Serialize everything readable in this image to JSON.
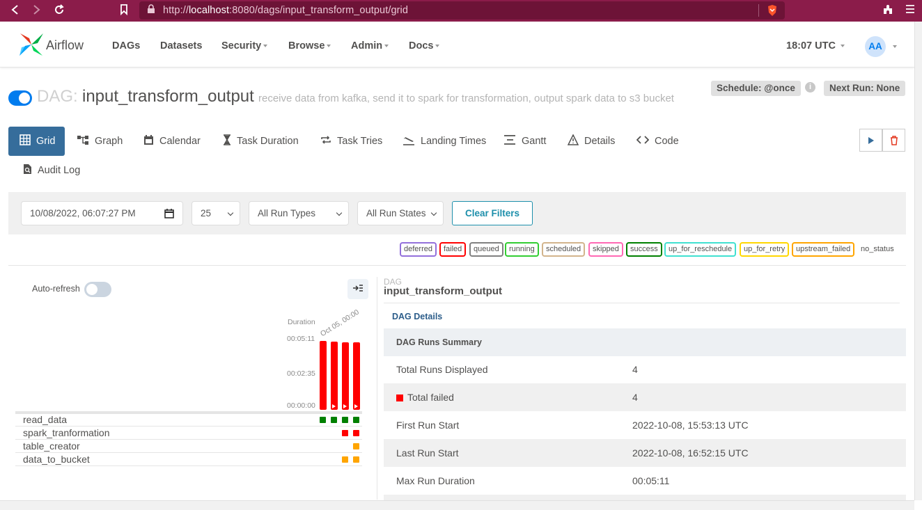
{
  "browser": {
    "url_prefix": "http://",
    "url_host": "localhost",
    "url_path": ":8080/dags/input_transform_output/grid"
  },
  "nav": {
    "brand": "Airflow",
    "items": [
      {
        "label": "DAGs"
      },
      {
        "label": "Datasets"
      },
      {
        "label": "Security"
      },
      {
        "label": "Browse"
      },
      {
        "label": "Admin"
      },
      {
        "label": "Docs"
      }
    ],
    "time": "18:07 UTC",
    "user_initials": "AA"
  },
  "dag": {
    "prefix": "DAG:",
    "name": "input_transform_output",
    "description": "receive data from kafka, send it to spark for transformation, output spark data to s3 bucket",
    "schedule": "Schedule: @once",
    "next_run": "Next Run: None"
  },
  "tabs": [
    {
      "label": "Grid",
      "icon": "grid-icon"
    },
    {
      "label": "Graph",
      "icon": "graph-icon"
    },
    {
      "label": "Calendar",
      "icon": "calendar-icon"
    },
    {
      "label": "Task Duration",
      "icon": "hourglass-icon"
    },
    {
      "label": "Task Tries",
      "icon": "retry-icon"
    },
    {
      "label": "Landing Times",
      "icon": "landing-icon"
    },
    {
      "label": "Gantt",
      "icon": "gantt-icon"
    },
    {
      "label": "Details",
      "icon": "warning-icon"
    },
    {
      "label": "Code",
      "icon": "code-icon"
    },
    {
      "label": "Audit Log",
      "icon": "audit-icon"
    }
  ],
  "filters": {
    "date": "10/08/2022, 06:07:27 PM",
    "limit": "25",
    "run_types": "All Run Types",
    "run_states": "All Run States",
    "clear": "Clear Filters"
  },
  "legend": [
    {
      "label": "deferred",
      "color": "#9370db"
    },
    {
      "label": "failed",
      "color": "#ff0000"
    },
    {
      "label": "queued",
      "color": "#808080"
    },
    {
      "label": "running",
      "color": "#32cd32"
    },
    {
      "label": "scheduled",
      "color": "#d2b48c"
    },
    {
      "label": "skipped",
      "color": "#ff69b4"
    },
    {
      "label": "success",
      "color": "#008000"
    },
    {
      "label": "up_for_reschedule",
      "color": "#40e0d0"
    },
    {
      "label": "up_for_retry",
      "color": "#ffd700"
    },
    {
      "label": "upstream_failed",
      "color": "#ffa500"
    },
    {
      "label": "no_status",
      "color": ""
    }
  ],
  "grid": {
    "auto_refresh": "Auto-refresh",
    "duration_label": "Duration",
    "date_label": "Oct 05, 00:00",
    "axis_ticks": [
      "00:05:11",
      "00:02:35",
      "00:00:00"
    ],
    "runs": [
      {
        "state": "failed",
        "duration_fraction": 0.97
      },
      {
        "state": "failed",
        "duration_fraction": 0.96
      },
      {
        "state": "failed",
        "duration_fraction": 0.95
      },
      {
        "state": "failed",
        "duration_fraction": 0.95
      }
    ],
    "tasks": [
      {
        "name": "read_data",
        "states": [
          "success",
          "success",
          "success",
          "success"
        ]
      },
      {
        "name": "spark_tranformation",
        "states": [
          "",
          "",
          "failed",
          "failed"
        ]
      },
      {
        "name": "table_creator",
        "states": [
          "",
          "",
          "",
          "upstream_failed"
        ]
      },
      {
        "name": "data_to_bucket",
        "states": [
          "",
          "",
          "upstream_failed",
          "upstream_failed"
        ]
      }
    ]
  },
  "details": {
    "kicker": "DAG",
    "title": "input_transform_output",
    "link": "DAG Details",
    "summary_header": "DAG Runs Summary",
    "rows": [
      {
        "key": "Total Runs Displayed",
        "value": "4"
      },
      {
        "key": "Total failed",
        "value": "4"
      },
      {
        "key": "First Run Start",
        "value": "2022-10-08, 15:53:13 UTC"
      },
      {
        "key": "Last Run Start",
        "value": "2022-10-08, 16:52:15 UTC"
      },
      {
        "key": "Max Run Duration",
        "value": "00:05:11"
      }
    ]
  }
}
